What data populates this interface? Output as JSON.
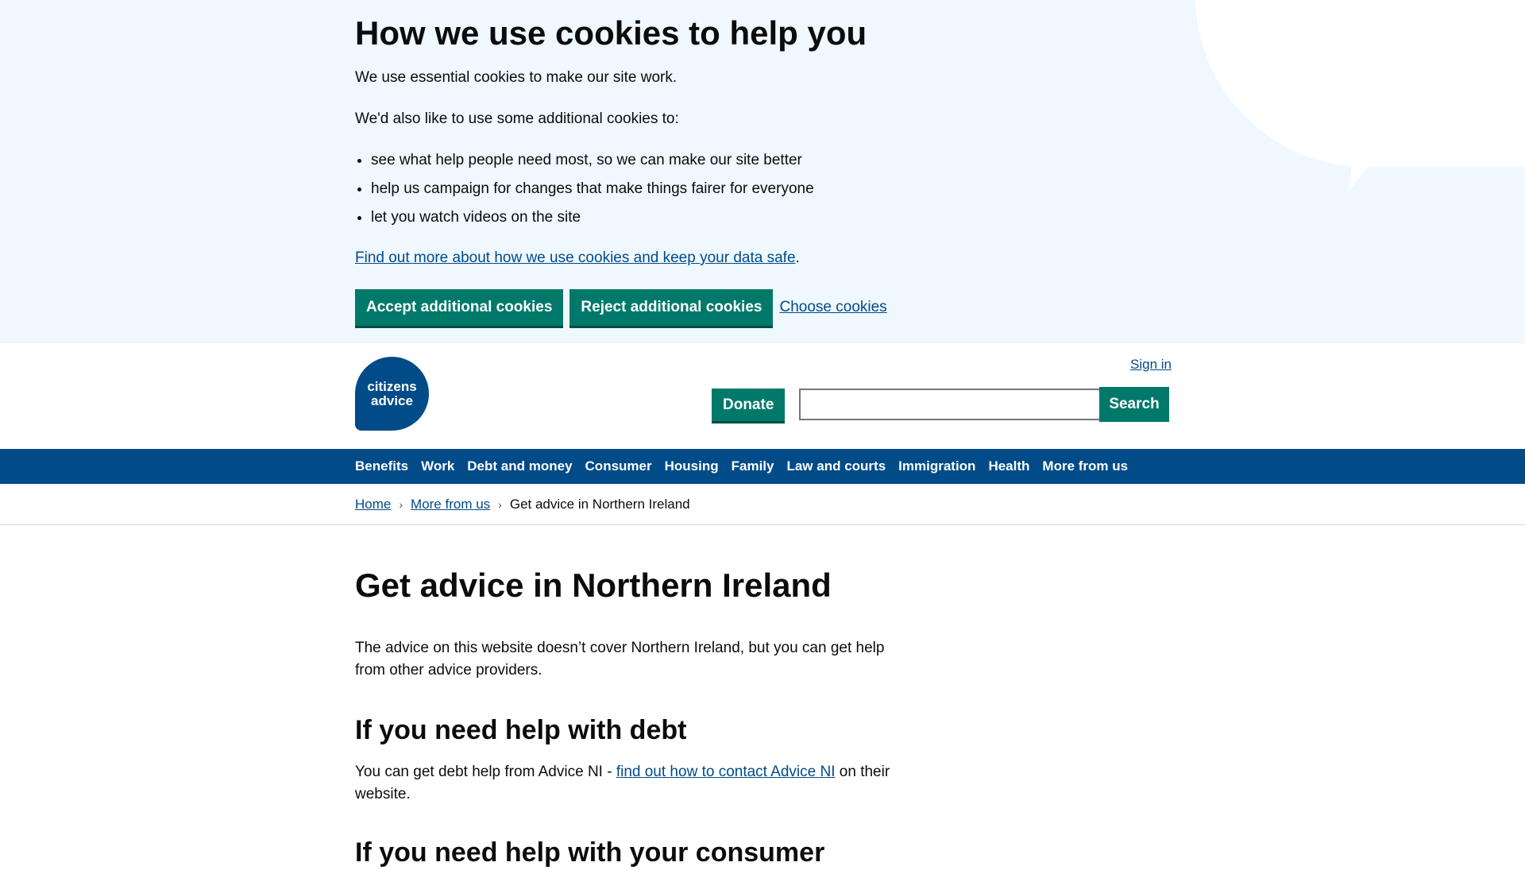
{
  "cookie_banner": {
    "title": "How we use cookies to help you",
    "essential_text": "We use essential cookies to make our site work.",
    "additional_intro": "We'd also like to use some additional cookies to:",
    "bullets": [
      "see what help people need most, so we can make our site better",
      "help us campaign for changes that make things fairer for everyone",
      "let you watch videos on the site"
    ],
    "more_link": "Find out more about how we use cookies and keep your data safe",
    "more_suffix": ".",
    "accept_label": "Accept additional cookies",
    "reject_label": "Reject additional cookies",
    "choose_label": "Choose cookies"
  },
  "header": {
    "logo_line1": "citizens",
    "logo_line2": "advice",
    "sign_in": "Sign in",
    "donate_label": "Donate",
    "search_placeholder": "",
    "search_value": "",
    "search_button": "Search"
  },
  "nav": {
    "items": [
      "Benefits",
      "Work",
      "Debt and money",
      "Consumer",
      "Housing",
      "Family",
      "Law and courts",
      "Immigration",
      "Health",
      "More from us"
    ]
  },
  "breadcrumb": {
    "home": "Home",
    "more_from_us": "More from us",
    "current": "Get advice in Northern Ireland"
  },
  "main": {
    "title": "Get advice in Northern Ireland",
    "intro": "The advice on this website doesn’t cover Northern Ireland, but you can get help from other advice providers.",
    "debt_heading": "If you need help with debt",
    "debt_text_before": "You can get debt help from Advice NI - ",
    "debt_link": "find out how to contact Advice NI",
    "debt_text_after": " on their website.",
    "consumer_heading": "If you need help with your consumer"
  },
  "colors": {
    "banner_bg": "#eff7ff",
    "brand_blue": "#004b88",
    "button_green": "#00796b"
  }
}
